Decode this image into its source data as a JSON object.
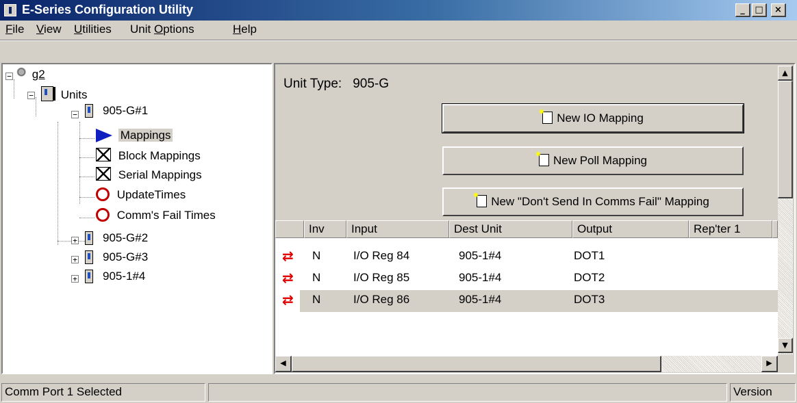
{
  "window": {
    "title": "E-Series Configuration Utility",
    "controls": {
      "minimize": "_",
      "maximize": "□",
      "close": "×"
    }
  },
  "menu": [
    {
      "label": "File",
      "mnemonic": "F",
      "rest": "ile"
    },
    {
      "label": "View",
      "mnemonic": "V",
      "rest": "iew"
    },
    {
      "label": "Utilities",
      "mnemonic": "U",
      "rest": "tilities"
    },
    {
      "label": "Unit Options",
      "prefix": "Unit ",
      "mnemonic": "O",
      "rest": "ptions"
    },
    {
      "label": "Help",
      "mnemonic": "H",
      "rest": "elp"
    }
  ],
  "tree": {
    "root": "g2",
    "units_label": "Units",
    "unit1": "905-G#1",
    "children": [
      "Mappings",
      "Block Mappings",
      "Serial Mappings",
      "UpdateTimes",
      "Comm's Fail Times"
    ],
    "selected": "Mappings",
    "other_units": [
      "905-G#2",
      "905-G#3",
      "905-1#4"
    ],
    "expanders": {
      "expanded": "−",
      "collapsed": "+"
    }
  },
  "main": {
    "unit_type_label": "Unit Type:",
    "unit_type_value": "905-G",
    "buttons": {
      "new_io": "New IO Mapping",
      "new_poll": "New Poll Mapping",
      "new_dont_send": "New \"Don't Send In Comms Fail\" Mapping"
    }
  },
  "table": {
    "columns": [
      "Inv",
      "Input",
      "Dest Unit",
      "Output",
      "Rep'ter 1"
    ],
    "rows": [
      {
        "inv": "N",
        "input": "I/O Reg 84",
        "dest": "905-1#4",
        "output": "DOT1"
      },
      {
        "inv": "N",
        "input": "I/O Reg 85",
        "dest": "905-1#4",
        "output": "DOT2"
      },
      {
        "inv": "N",
        "input": "I/O Reg 86",
        "dest": "905-1#4",
        "output": "DOT3"
      }
    ],
    "selected_row": 3,
    "row_icon": "⇄"
  },
  "scroll": {
    "up": "▲",
    "down": "▼",
    "left": "◀",
    "right": "▶"
  },
  "status": {
    "left": "Comm Port 1 Selected",
    "right": "Version"
  },
  "colors": {
    "titlebar": "#0a246a",
    "arrow_red": "#e00000",
    "selection": "#d4d0c8"
  }
}
